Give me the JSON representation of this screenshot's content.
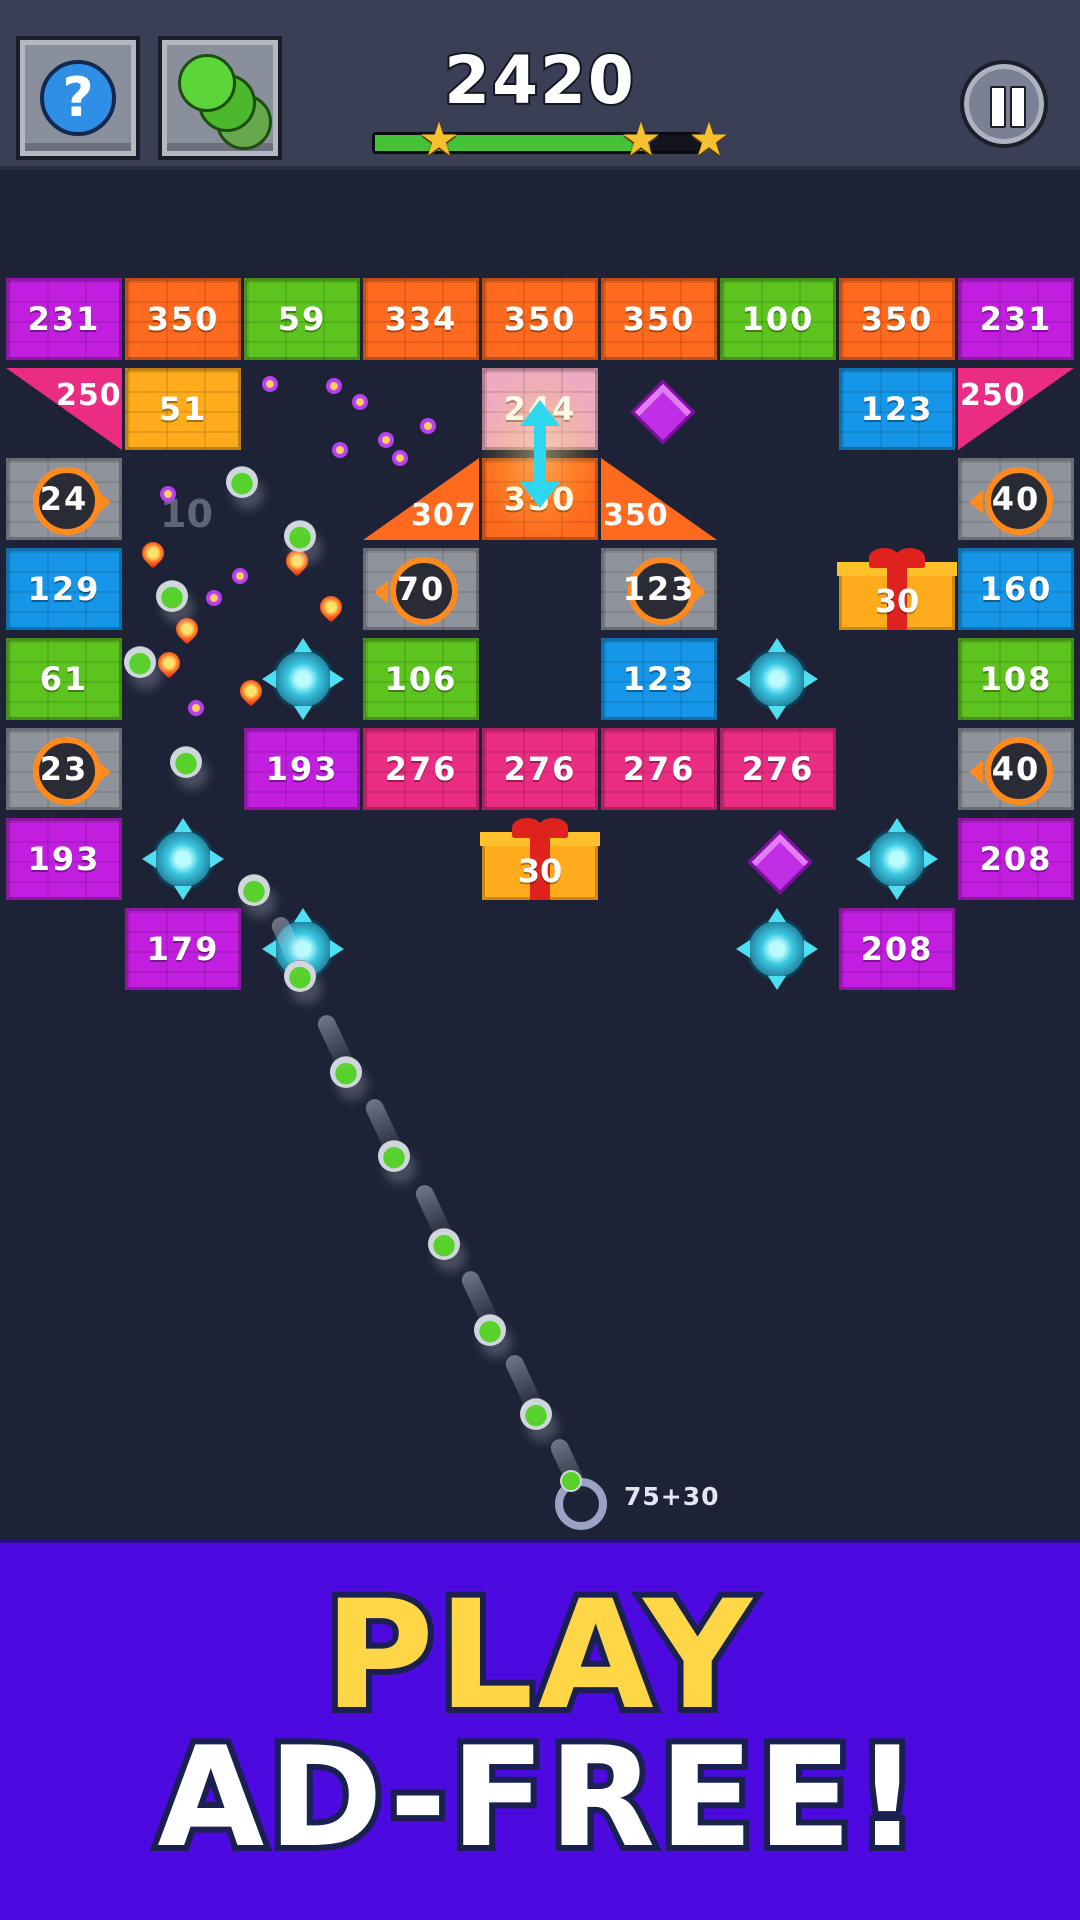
{
  "hud": {
    "help_symbol": "?",
    "score": "2420",
    "score_progress": 0.85,
    "stars_earned": 3,
    "star_symbol": "★",
    "help_icon": "question-mark-icon",
    "balls_icon": "balls-skin-icon",
    "pause_icon": "pause-icon"
  },
  "board": {
    "rows": [
      [
        "231",
        "350",
        "59",
        "334",
        "350",
        "350",
        "100",
        "350",
        "231"
      ],
      [
        "250",
        "51",
        "244",
        "123",
        "250"
      ],
      [
        "24",
        "307",
        "350",
        "350",
        "40"
      ],
      [
        "129",
        "70",
        "123",
        "30",
        "160"
      ],
      [
        "61",
        "106",
        "123",
        "108"
      ],
      [
        "23",
        "193",
        "276",
        "276",
        "276",
        "276",
        "40"
      ],
      [
        "193",
        "30",
        "208"
      ],
      [
        "179",
        "208"
      ]
    ],
    "ghost_number": "10"
  },
  "launcher": {
    "ball_count": "75+30"
  },
  "promo": {
    "line1": "PLAY",
    "line2": "AD-FREE!"
  },
  "colors": {
    "background": "#1e2236",
    "topbar": "#3a3f55",
    "promo_bg": "#4c0ae0",
    "promo_yellow": "#ffd646",
    "ball_green": "#59d12c",
    "star": "#f6c12e"
  }
}
